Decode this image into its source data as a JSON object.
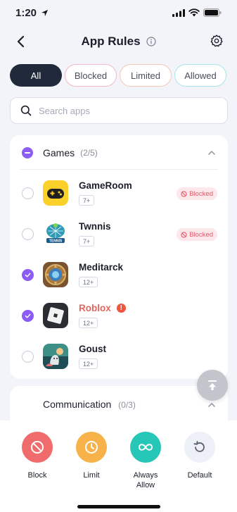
{
  "status_bar": {
    "time": "1:20"
  },
  "nav": {
    "title": "App Rules"
  },
  "filters": [
    {
      "label": "All"
    },
    {
      "label": "Blocked"
    },
    {
      "label": "Limited"
    },
    {
      "label": "Allowed"
    }
  ],
  "search": {
    "placeholder": "Search apps"
  },
  "groups": {
    "games": {
      "title": "Games",
      "count": "(2/5)",
      "apps": [
        {
          "name": "GameRoom",
          "age": "7+",
          "status": "Blocked",
          "checked": false,
          "icon": "gamepad-icon"
        },
        {
          "name": "Twnnis",
          "age": "7+",
          "status": "Blocked",
          "checked": false,
          "icon": "tennis-icon"
        },
        {
          "name": "Meditarck",
          "age": "12+",
          "status": "",
          "checked": true,
          "icon": "hearthstone-icon"
        },
        {
          "name": "Roblox",
          "age": "12+",
          "status": "",
          "checked": true,
          "warning": "!",
          "icon": "roblox-icon"
        },
        {
          "name": "Goust",
          "age": "12+",
          "status": "",
          "checked": false,
          "icon": "ghost-game-icon"
        }
      ]
    },
    "communication": {
      "title": "Communication",
      "count": "(0/3)"
    }
  },
  "actions": {
    "block": "Block",
    "limit": "Limit",
    "always_allow_1": "Always",
    "always_allow_2": "Allow",
    "default": "Default"
  },
  "colors": {
    "accent": "#8B5CF6",
    "block": "#F06B6B",
    "limit": "#F7B24A",
    "allow": "#27C7B8",
    "default": "#EEF0F8",
    "blocked_badge_bg": "#FCE8EB",
    "blocked_badge_text": "#E25A6C"
  }
}
